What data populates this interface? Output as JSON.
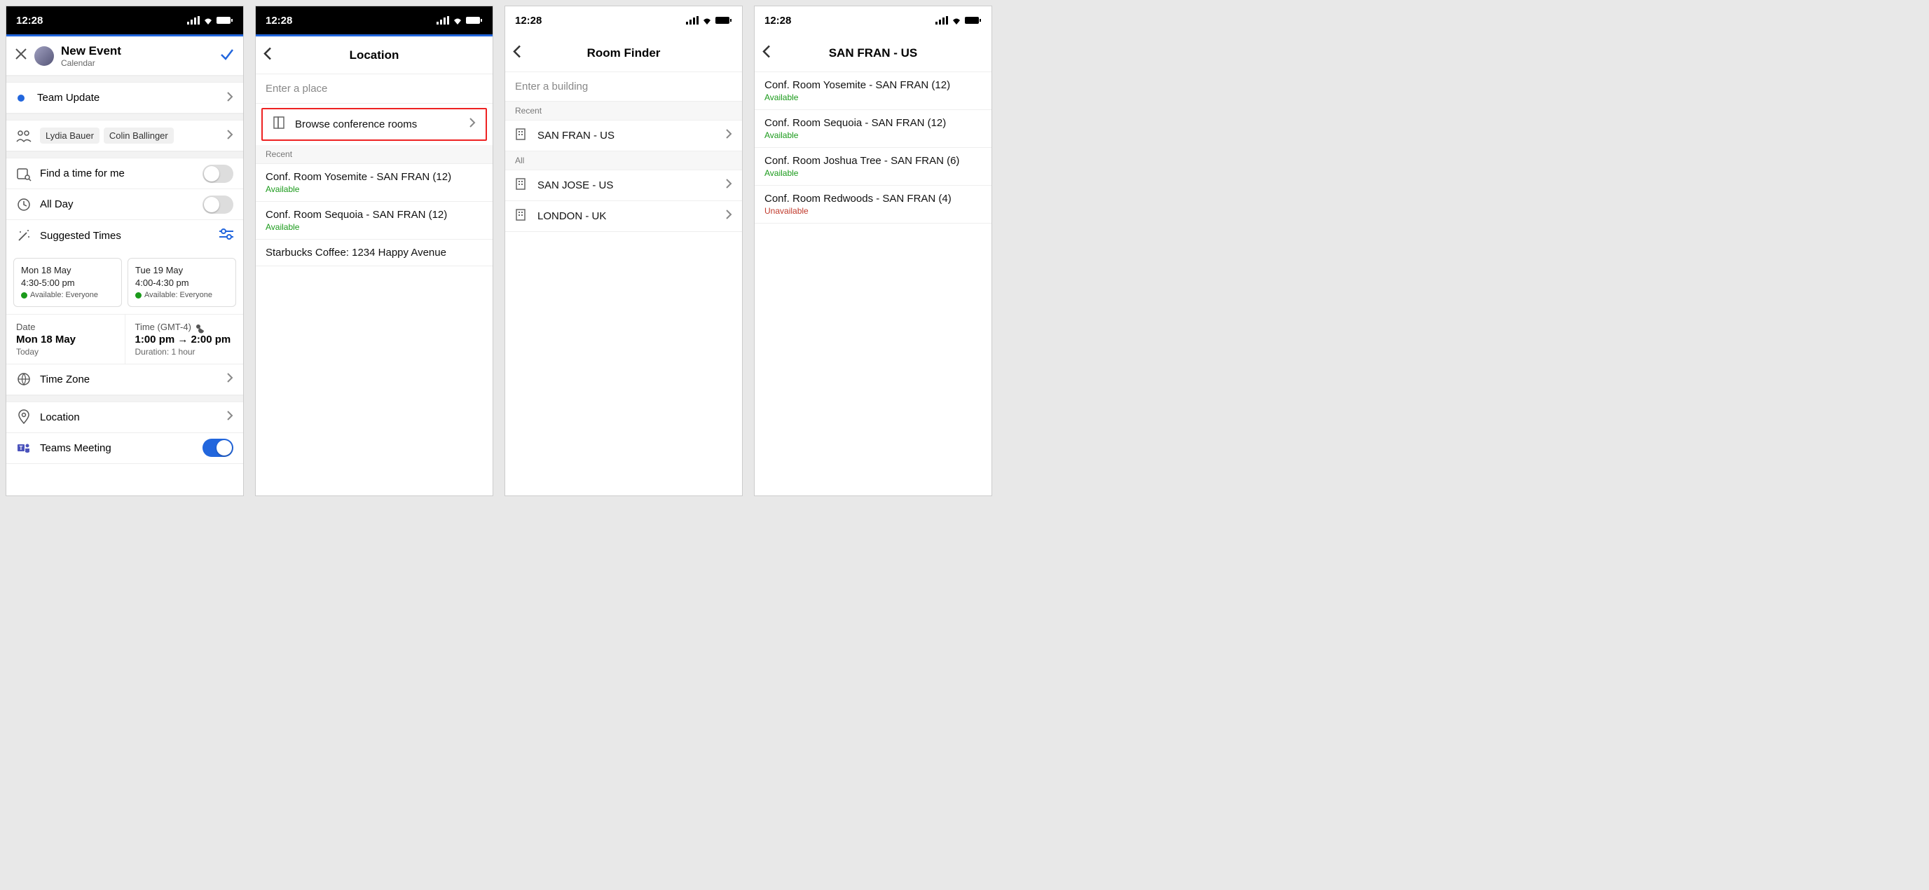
{
  "status_time": "12:28",
  "screen1": {
    "title": "New Event",
    "subtitle": "Calendar",
    "event_title": "Team Update",
    "attendee1": "Lydia Bauer",
    "attendee2": "Colin Ballinger",
    "find_time": "Find a time for me",
    "all_day": "All Day",
    "suggested": "Suggested Times",
    "card1_date": "Mon 18 May",
    "card1_time": "4:30-5:00 pm",
    "card1_avail": "Available: Everyone",
    "card2_date": "Tue 19 May",
    "card2_time": "4:00-4:30 pm",
    "card2_avail": "Available: Everyone",
    "date_label": "Date",
    "date_val": "Mon 18 May",
    "date_sub": "Today",
    "time_label": "Time (GMT-4)",
    "time_from": "1:00 pm",
    "time_to": "2:00 pm",
    "time_sub": "Duration: 1 hour",
    "timezone": "Time Zone",
    "location": "Location",
    "teams": "Teams Meeting"
  },
  "screen2": {
    "title": "Location",
    "search_placeholder": "Enter a place",
    "browse": "Browse conference rooms",
    "recent_label": "Recent",
    "room1_name": "Conf. Room Yosemite - SAN FRAN (12)",
    "room1_status": "Available",
    "room2_name": "Conf. Room Sequoia - SAN FRAN (12)",
    "room2_status": "Available",
    "place1": "Starbucks Coffee: 1234 Happy Avenue"
  },
  "screen3": {
    "title": "Room Finder",
    "search_placeholder": "Enter a building",
    "recent_label": "Recent",
    "all_label": "All",
    "b1": "SAN FRAN - US",
    "b2": "SAN JOSE - US",
    "b3": "LONDON - UK"
  },
  "screen4": {
    "title": "SAN FRAN - US",
    "r1_name": "Conf. Room Yosemite - SAN FRAN (12)",
    "r1_status": "Available",
    "r2_name": "Conf. Room Sequoia - SAN FRAN (12)",
    "r2_status": "Available",
    "r3_name": "Conf. Room Joshua Tree - SAN FRAN (6)",
    "r3_status": "Available",
    "r4_name": "Conf. Room Redwoods - SAN FRAN (4)",
    "r4_status": "Unavailable"
  }
}
